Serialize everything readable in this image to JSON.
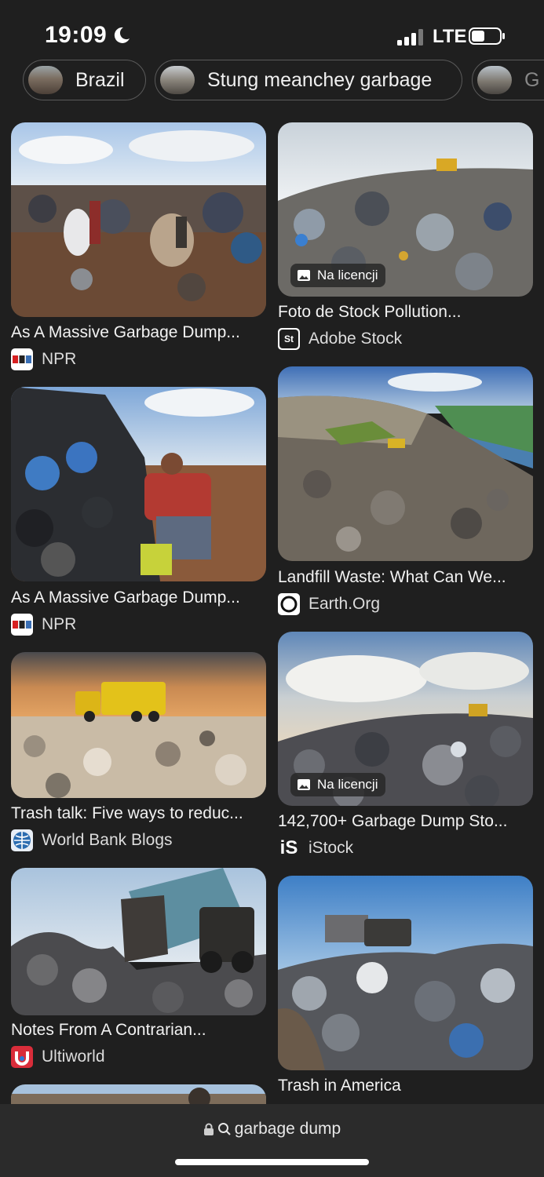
{
  "status_bar": {
    "time": "19:09",
    "network": "LTE"
  },
  "chips": [
    {
      "label": "Brazil"
    },
    {
      "label": "Stung meanchey garbage"
    },
    {
      "label": "G"
    }
  ],
  "results": [
    {
      "title": "As A Massive Garbage Dump...",
      "source": "NPR",
      "favicon": "npr-icon"
    },
    {
      "title": "Foto de Stock Pollution...",
      "source": "Adobe Stock",
      "favicon": "adobe-stock-icon",
      "badge": "Na licencji"
    },
    {
      "title": "As A Massive Garbage Dump...",
      "source": "NPR",
      "favicon": "npr-icon"
    },
    {
      "title": "Landfill Waste: What Can We...",
      "source": "Earth.Org",
      "favicon": "earth-org-icon"
    },
    {
      "title": "Trash talk: Five ways to reduc...",
      "source": "World Bank Blogs",
      "favicon": "world-bank-icon"
    },
    {
      "title": "142,700+ Garbage Dump Sto...",
      "source": "iStock",
      "favicon": "istock-icon",
      "badge": "Na licencji"
    },
    {
      "title": "Notes From A Contrarian...",
      "source": "Ultiworld",
      "favicon": "ultiworld-icon"
    },
    {
      "title": "Trash in America",
      "source": "",
      "favicon": ""
    }
  ],
  "address_bar": {
    "url": "garbage dump"
  },
  "colors": {
    "background": "#1f1f1f",
    "bottom_bar": "#2b2b2b"
  }
}
